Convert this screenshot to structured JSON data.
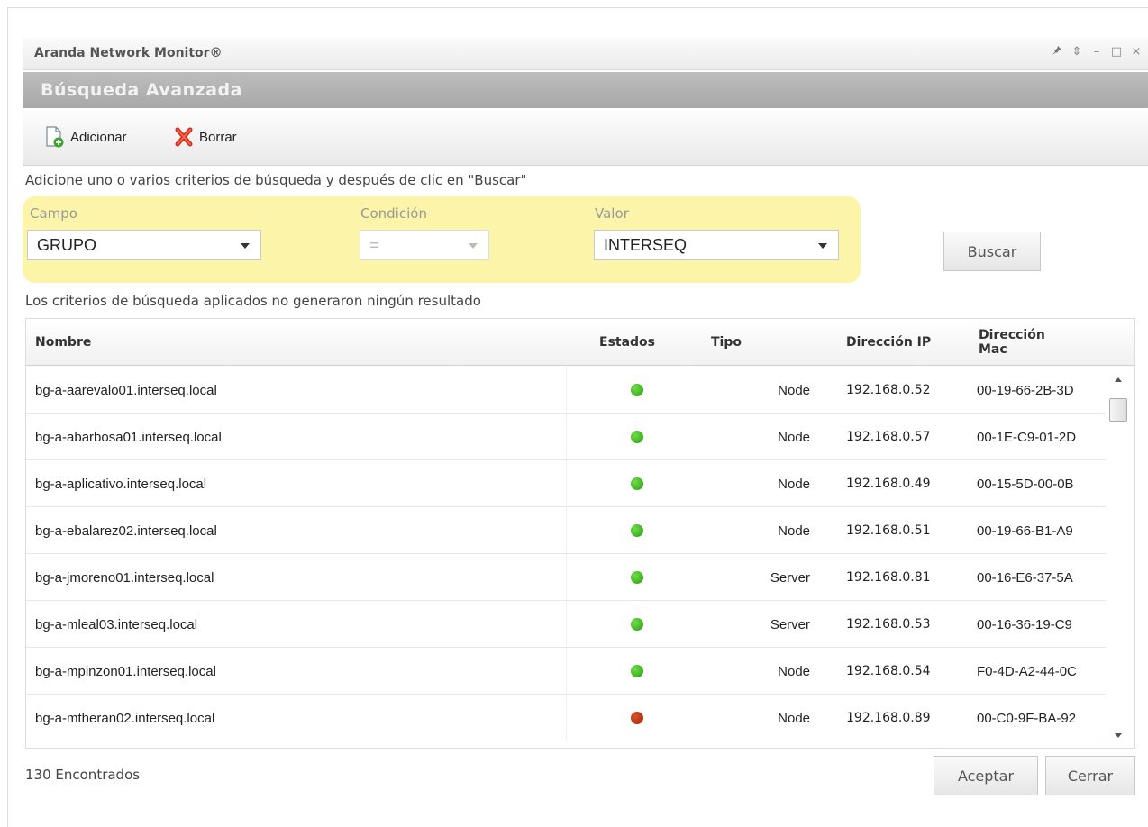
{
  "window": {
    "title": "Aranda Network Monitor®",
    "controls": [
      "pin-icon",
      "refresh-icon",
      "minimize-icon",
      "maximize-icon",
      "close-icon"
    ]
  },
  "section": {
    "title": "Búsqueda Avanzada"
  },
  "toolbar": {
    "add_label": "Adicionar",
    "delete_label": "Borrar"
  },
  "hint": "Adicione uno o varios criterios de búsqueda y después de clic en \"Buscar\"",
  "criteria": {
    "campo_label": "Campo",
    "campo_value": "GRUPO",
    "condicion_label": "Condición",
    "condicion_value": "=",
    "valor_label": "Valor",
    "valor_value": "INTERSEQ",
    "search_button": "Buscar"
  },
  "no_results": "Los criterios de búsqueda aplicados no generaron ningún resultado",
  "table": {
    "headers": [
      "Nombre",
      "Estados",
      "Tipo",
      "Dirección IP",
      "Dirección Mac"
    ],
    "rows": [
      {
        "name": "bg-a-aarevalo01.interseq.local",
        "status": "green",
        "type": "Node",
        "ip": "192.168.0.52",
        "mac": "00-19-66-2B-3D"
      },
      {
        "name": "bg-a-abarbosa01.interseq.local",
        "status": "green",
        "type": "Node",
        "ip": "192.168.0.57",
        "mac": "00-1E-C9-01-2D"
      },
      {
        "name": "bg-a-aplicativo.interseq.local",
        "status": "green",
        "type": "Node",
        "ip": "192.168.0.49",
        "mac": "00-15-5D-00-0B"
      },
      {
        "name": "bg-a-ebalarez02.interseq.local",
        "status": "green",
        "type": "Node",
        "ip": "192.168.0.51",
        "mac": "00-19-66-B1-A9"
      },
      {
        "name": "bg-a-jmoreno01.interseq.local",
        "status": "green",
        "type": "Server",
        "ip": "192.168.0.81",
        "mac": "00-16-E6-37-5A"
      },
      {
        "name": "bg-a-mleal03.interseq.local",
        "status": "green",
        "type": "Server",
        "ip": "192.168.0.53",
        "mac": "00-16-36-19-C9"
      },
      {
        "name": "bg-a-mpinzon01.interseq.local",
        "status": "green",
        "type": "Node",
        "ip": "192.168.0.54",
        "mac": "F0-4D-A2-44-0C"
      },
      {
        "name": "bg-a-mtheran02.interseq.local",
        "status": "red",
        "type": "Node",
        "ip": "192.168.0.89",
        "mac": "00-C0-9F-BA-92"
      }
    ]
  },
  "footer": {
    "count": "130 Encontrados",
    "accept_button": "Aceptar",
    "close_button": "Cerrar"
  }
}
